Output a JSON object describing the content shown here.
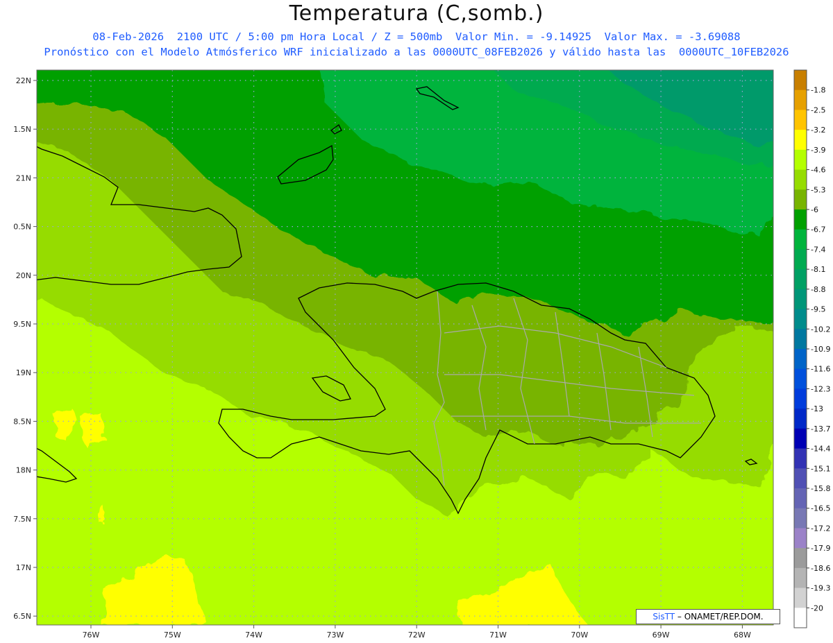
{
  "header": {
    "title": "Temperatura (C,somb.)",
    "line1": "08-Feb-2026  2100 UTC / 5:00 pm Hora Local / Z = 500mb  Valor Min. = -9.14925  Valor Max. = -3.69088",
    "line2": "Pronóstico con el Modelo Atmósferico WRF inicializado a las 0000UTC_08FEB2026 y válido hasta las  0000UTC_10FEB2026"
  },
  "axes": {
    "lat_labels": [
      "22N",
      "1.5N",
      "21N",
      "0.5N",
      "20N",
      "9.5N",
      "19N",
      "8.5N",
      "18N",
      "7.5N",
      "17N",
      "6.5N"
    ],
    "lon_labels": [
      "76W",
      "75W",
      "74W",
      "73W",
      "72W",
      "71W",
      "70W",
      "69W",
      "68W"
    ]
  },
  "colorbar": {
    "labels": [
      "-1.8",
      "-2.5",
      "-3.2",
      "-3.9",
      "-4.6",
      "-5.3",
      "-6",
      "-6.7",
      "-7.4",
      "-8.1",
      "-8.8",
      "-9.5",
      "-10.2",
      "-10.9",
      "-11.6",
      "-12.3",
      "-13",
      "-13.7",
      "-14.4",
      "-15.1",
      "-15.8",
      "-16.5",
      "-17.2",
      "-17.9",
      "-18.6",
      "-19.3",
      "-20"
    ],
    "colors": [
      "#c87f00",
      "#e6a000",
      "#ffc400",
      "#ffff00",
      "#b4ff00",
      "#96dc00",
      "#78b400",
      "#00a000",
      "#00b43c",
      "#00aa50",
      "#00a064",
      "#009678",
      "#008c8c",
      "#0078a0",
      "#0064c8",
      "#0050dc",
      "#003cdc",
      "#0028c8",
      "#0000b4",
      "#3232b4",
      "#5050b4",
      "#6464b4",
      "#7878b4",
      "#9b82c8",
      "#9b9b9b",
      "#b4b4b4",
      "#d2d2d2",
      "#ffffff"
    ]
  },
  "credit": {
    "brand": "SisTT",
    "text": " – ONAMET/REP.DOM."
  }
}
